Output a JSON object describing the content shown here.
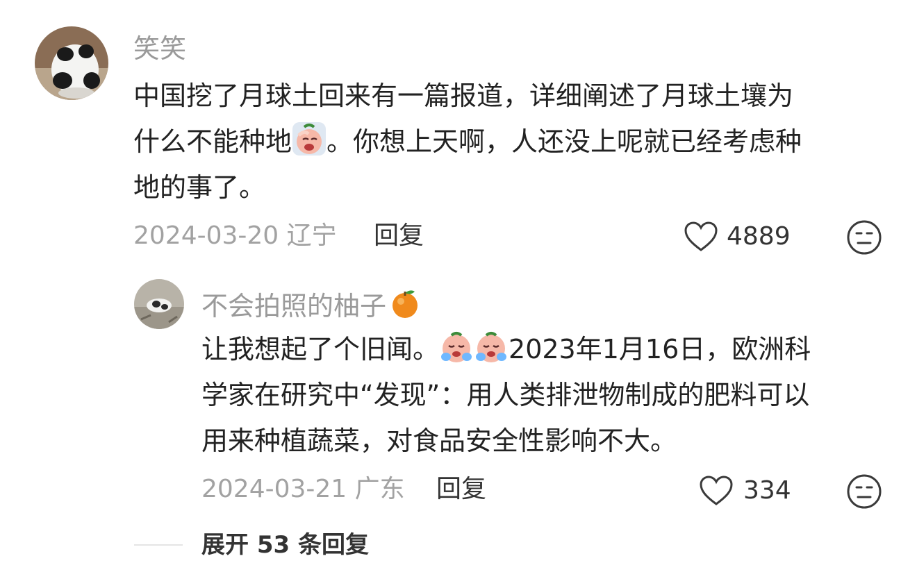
{
  "comment": {
    "username": "笑笑",
    "text_lines": [
      "中国挖了月球土回来有一篇报道，详细阐述了月球土壤为",
      "什么不能种地",
      "。你想上天啊，人还没上呢就已经考虑种",
      "地的事了。"
    ],
    "date": "2024-03-20",
    "location": "辽宁",
    "reply_label": "回复",
    "likes": "4889"
  },
  "reply": {
    "username": "不会拍照的柚子",
    "text_lines": [
      "让我想起了个旧闻。",
      "2023年1月16日，欧洲科",
      "学家在研究中“发现”：用人类排泄物制成的肥料可以",
      "用来种植蔬菜，对食品安全性影响不大。"
    ],
    "date": "2024-03-21",
    "location": "广东",
    "reply_label": "回复",
    "likes": "334"
  },
  "expand": {
    "label": "展开 53 条回复"
  },
  "icons": {
    "like": "heart-icon",
    "dislike": "neutral-face-icon",
    "username_emoji": "orange-icon",
    "inline_emoji_1": "facepalm-sticker-icon",
    "inline_emoji_2": "crying-sticker-icon"
  }
}
